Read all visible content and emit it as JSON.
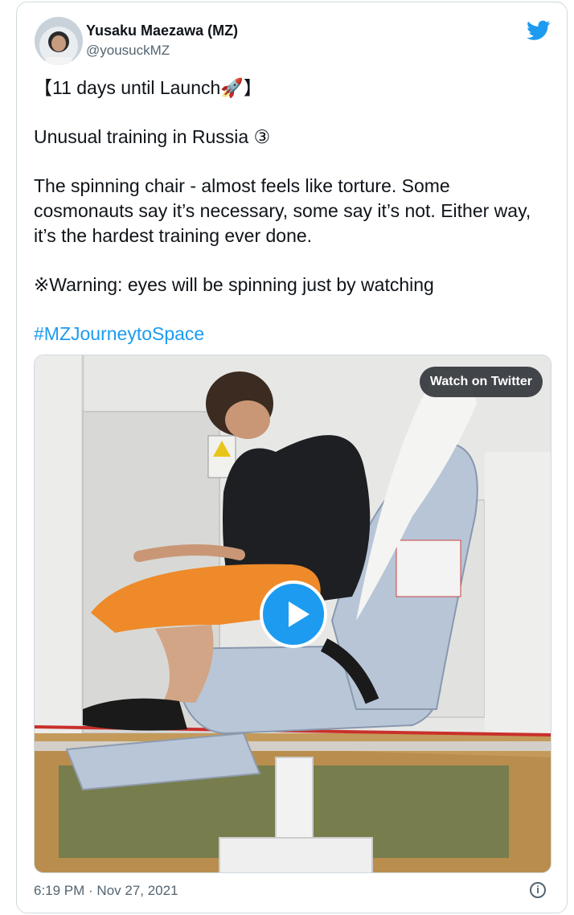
{
  "author": {
    "name": "Yusaku Maezawa (MZ)",
    "handle": "@yousuckMZ"
  },
  "tweet": {
    "line1": "【11 days until Launch🚀】",
    "line2": "Unusual training in Russia ③",
    "line3": "The spinning chair - almost feels like torture. Some cosmonauts say it’s necessary, some say it’s not. Either way, it’s the hardest training ever done.",
    "line4": "※Warning: eyes will be spinning just by watching",
    "hashtag": "#MZJourneytoSpace"
  },
  "media": {
    "watch_label": "Watch on Twitter"
  },
  "footer": {
    "timestamp": "6:19 PM · Nov 27, 2021",
    "info_glyph": "i"
  },
  "colors": {
    "accent": "#1d9bf0",
    "text": "#0f1419",
    "secondary": "#536471",
    "border": "#cfd9de"
  },
  "icons": [
    "twitter-bird-icon",
    "play-icon",
    "info-icon"
  ]
}
